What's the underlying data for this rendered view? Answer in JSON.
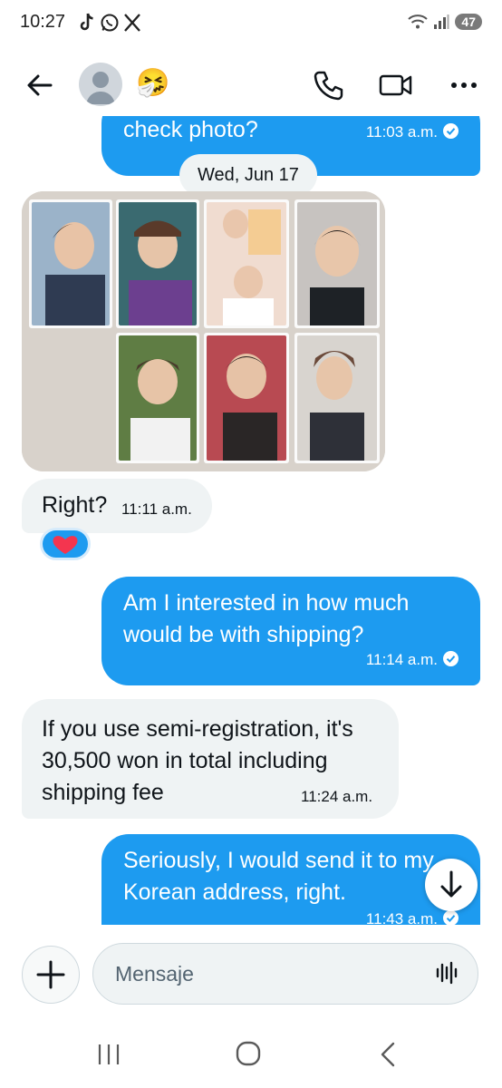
{
  "status_bar": {
    "time": "10:27",
    "battery": "47",
    "left_icons": [
      "tiktok-icon",
      "whatsapp-icon",
      "x-icon"
    ],
    "right_icons": [
      "wifi-icon",
      "signal-icon"
    ]
  },
  "header": {
    "contact_emoji": "🤧",
    "icons": [
      "back-arrow-icon",
      "avatar-icon",
      "phone-icon",
      "video-icon",
      "more-icon"
    ]
  },
  "colors": {
    "accent": "#1d9bf0",
    "incoming_bubble": "#eff3f4",
    "text": "#0f1419",
    "secondary_text": "#536471"
  },
  "messages": [
    {
      "direction": "outgoing",
      "text": "check photo?",
      "time": "11:03 a.m.",
      "seen": true
    },
    {
      "type": "date_separator",
      "text": "Wed, Jun 17"
    },
    {
      "direction": "incoming",
      "type": "photo",
      "description_icon": "photocards-image"
    },
    {
      "direction": "incoming",
      "text": "Right?",
      "time": "11:11 a.m.",
      "reaction": "heart"
    },
    {
      "direction": "outgoing",
      "text": "Am I interested in how much would be with shipping?",
      "time": "11:14 a.m.",
      "seen": true
    },
    {
      "direction": "incoming",
      "text": "If you use semi-registration, it's 30,500 won in total including shipping fee",
      "time": "11:24 a.m."
    },
    {
      "direction": "outgoing",
      "text": "Seriously, I would send it to my Korean address, right.",
      "time": "11:43 a.m.",
      "seen": true
    }
  ],
  "composer": {
    "placeholder": "Mensaje",
    "icons": [
      "plus-icon",
      "voice-message-icon"
    ]
  },
  "navigation": {
    "icons": [
      "recent-apps-icon",
      "home-icon",
      "back-icon"
    ]
  }
}
